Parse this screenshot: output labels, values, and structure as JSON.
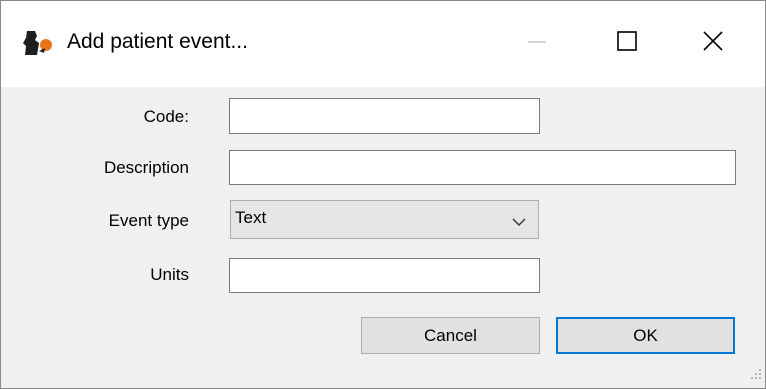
{
  "window": {
    "title": "Add patient event...",
    "icon": "msupply-app-icon"
  },
  "titlebar_buttons": {
    "minimize_icon": "minimize-icon",
    "maximize_icon": "maximize-icon",
    "close_icon": "close-icon"
  },
  "form": {
    "code": {
      "label": "Code:",
      "value": ""
    },
    "description": {
      "label": "Description",
      "value": ""
    },
    "event_type": {
      "label": "Event type",
      "selected": "Text"
    },
    "units": {
      "label": "Units",
      "value": ""
    }
  },
  "buttons": {
    "cancel": "Cancel",
    "ok": "OK"
  },
  "colors": {
    "accent": "#0078d7",
    "dialog_bg": "#f0f0f0",
    "titlebar_bg": "#ffffff",
    "app_icon_orange": "#e8741e"
  }
}
